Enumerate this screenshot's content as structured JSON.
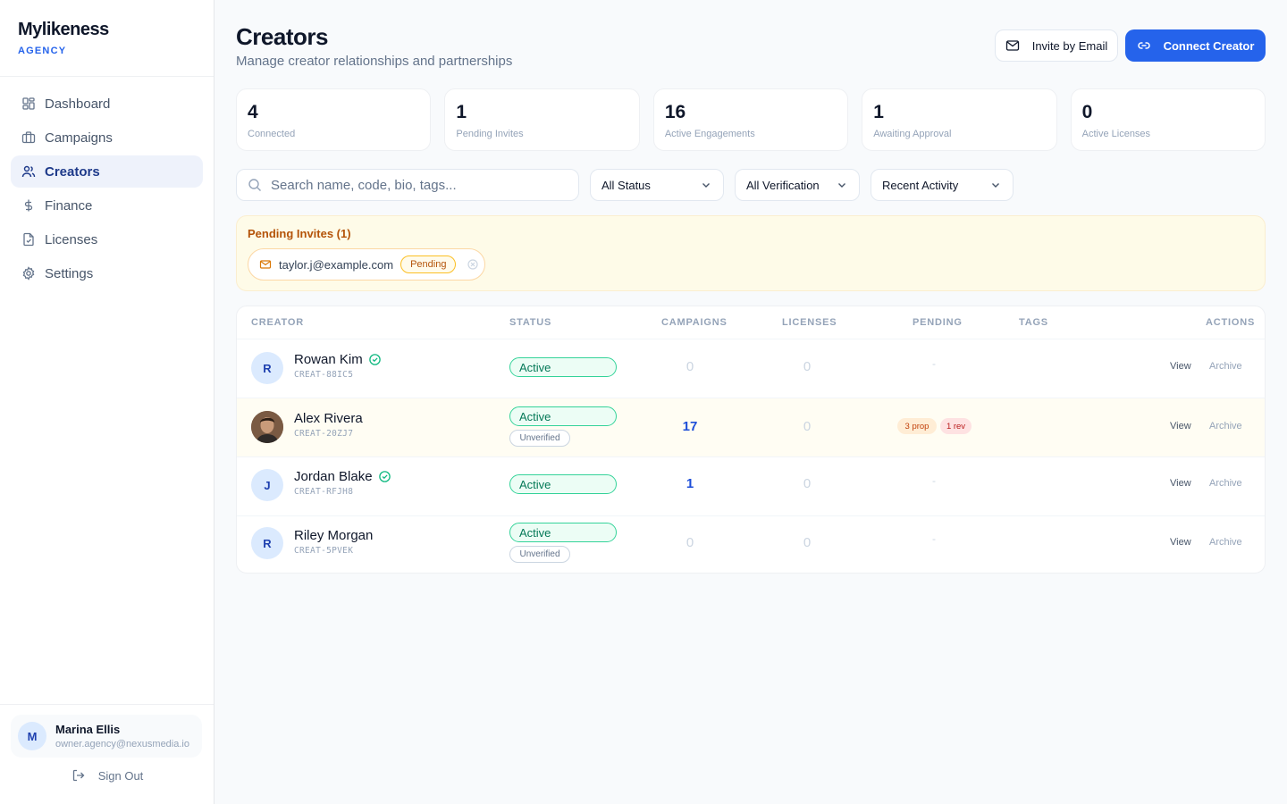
{
  "brand": {
    "name": "Mylikeness",
    "sub": "AGENCY"
  },
  "nav": [
    {
      "label": "Dashboard",
      "icon": "dashboard-icon"
    },
    {
      "label": "Campaigns",
      "icon": "briefcase-icon"
    },
    {
      "label": "Creators",
      "icon": "users-icon",
      "active": true
    },
    {
      "label": "Finance",
      "icon": "dollar-icon"
    },
    {
      "label": "Licenses",
      "icon": "license-icon"
    },
    {
      "label": "Settings",
      "icon": "gear-icon"
    }
  ],
  "user": {
    "initial": "M",
    "name": "Marina Ellis",
    "email": "owner.agency@nexusmedia.io"
  },
  "signout_label": "Sign Out",
  "header": {
    "title": "Creators",
    "subtitle": "Manage creator relationships and partnerships",
    "invite_label": "Invite by Email",
    "connect_label": "Connect Creator"
  },
  "stats": [
    {
      "value": "4",
      "label": "Connected"
    },
    {
      "value": "1",
      "label": "Pending Invites"
    },
    {
      "value": "16",
      "label": "Active Engagements"
    },
    {
      "value": "1",
      "label": "Awaiting Approval"
    },
    {
      "value": "0",
      "label": "Active Licenses"
    }
  ],
  "filters": {
    "search_placeholder": "Search name, code, bio, tags...",
    "status": "All Status",
    "verification": "All Verification",
    "sort": "Recent Activity"
  },
  "pending_invites": {
    "title": "Pending Invites (1)",
    "items": [
      {
        "email": "taylor.j@example.com",
        "status": "Pending"
      }
    ]
  },
  "table": {
    "columns": [
      "CREATOR",
      "STATUS",
      "CAMPAIGNS",
      "LICENSES",
      "PENDING",
      "TAGS",
      "ACTIONS"
    ],
    "view_label": "View",
    "archive_label": "Archive",
    "dash": "-",
    "rows": [
      {
        "initial": "R",
        "name": "Rowan Kim",
        "code": "CREAT-88IC5",
        "verified": true,
        "status": "Active",
        "verification": "",
        "campaigns": "0",
        "licenses": "0",
        "pending": []
      },
      {
        "initial": "",
        "name": "Alex Rivera",
        "code": "CREAT-20ZJ7",
        "verified": false,
        "status": "Active",
        "verification": "Unverified",
        "campaigns": "17",
        "licenses": "0",
        "pending": [
          "3 prop",
          "1 rev"
        ]
      },
      {
        "initial": "J",
        "name": "Jordan Blake",
        "code": "CREAT-RFJH8",
        "verified": true,
        "status": "Active",
        "verification": "",
        "campaigns": "1",
        "licenses": "0",
        "pending": []
      },
      {
        "initial": "R",
        "name": "Riley Morgan",
        "code": "CREAT-5PVEK",
        "verified": false,
        "status": "Active",
        "verification": "Unverified",
        "campaigns": "0",
        "licenses": "0",
        "pending": []
      }
    ]
  },
  "colors": {
    "accent": "#2563eb",
    "active_green": "#047857",
    "pending_amber": "#b45309"
  }
}
